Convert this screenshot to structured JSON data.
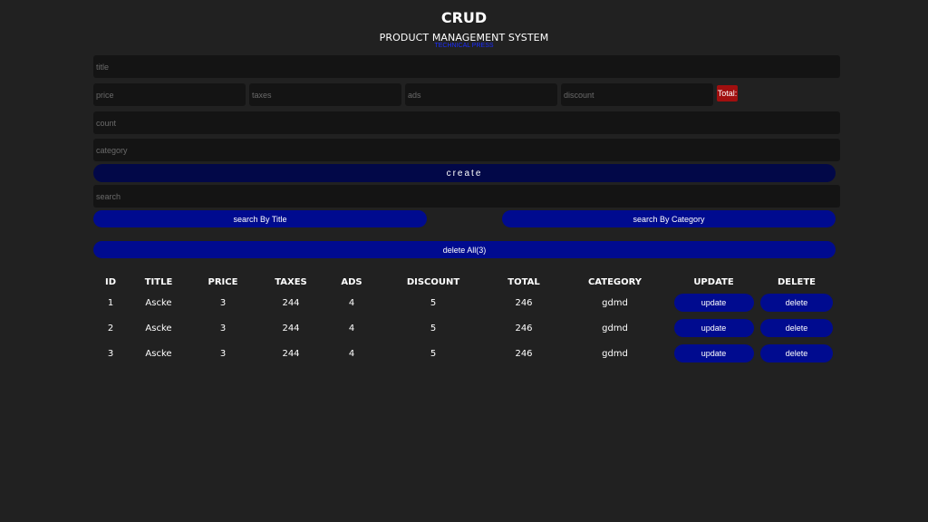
{
  "header": {
    "title": "CRUD",
    "subtitle": "PRODUCT MANAGEMENT SYSTEM",
    "author": "TECHNICAL PRESS"
  },
  "form": {
    "title_placeholder": "title",
    "price_placeholder": "price",
    "taxes_placeholder": "taxes",
    "ads_placeholder": "ads",
    "discount_placeholder": "discount",
    "total_label": "Total:",
    "count_placeholder": "count",
    "category_placeholder": "category",
    "create_label": "create"
  },
  "search": {
    "placeholder": "search",
    "by_title_label": "search By Title",
    "by_category_label": "search By Category",
    "delete_all_label": "delete All(3)"
  },
  "table": {
    "headers": [
      "ID",
      "TITLE",
      "PRICE",
      "TAXES",
      "ADS",
      "DISCOUNT",
      "TOTAL",
      "CATEGORY",
      "UPDATE",
      "DELETE"
    ],
    "update_label": "update",
    "delete_label": "delete",
    "rows": [
      {
        "id": "1",
        "title": "Ascke",
        "price": "3",
        "taxes": "244",
        "ads": "4",
        "discount": "5",
        "total": "246",
        "category": "gdmd"
      },
      {
        "id": "2",
        "title": "Ascke",
        "price": "3",
        "taxes": "244",
        "ads": "4",
        "discount": "5",
        "total": "246",
        "category": "gdmd"
      },
      {
        "id": "3",
        "title": "Ascke",
        "price": "3",
        "taxes": "244",
        "ads": "4",
        "discount": "5",
        "total": "246",
        "category": "gdmd"
      }
    ]
  },
  "colors": {
    "background": "#212121",
    "input_bg": "#141414",
    "button_blue": "#000b8f",
    "create_button": "#020848",
    "total_badge": "#a10f0f",
    "author_link": "#1b2cff"
  }
}
